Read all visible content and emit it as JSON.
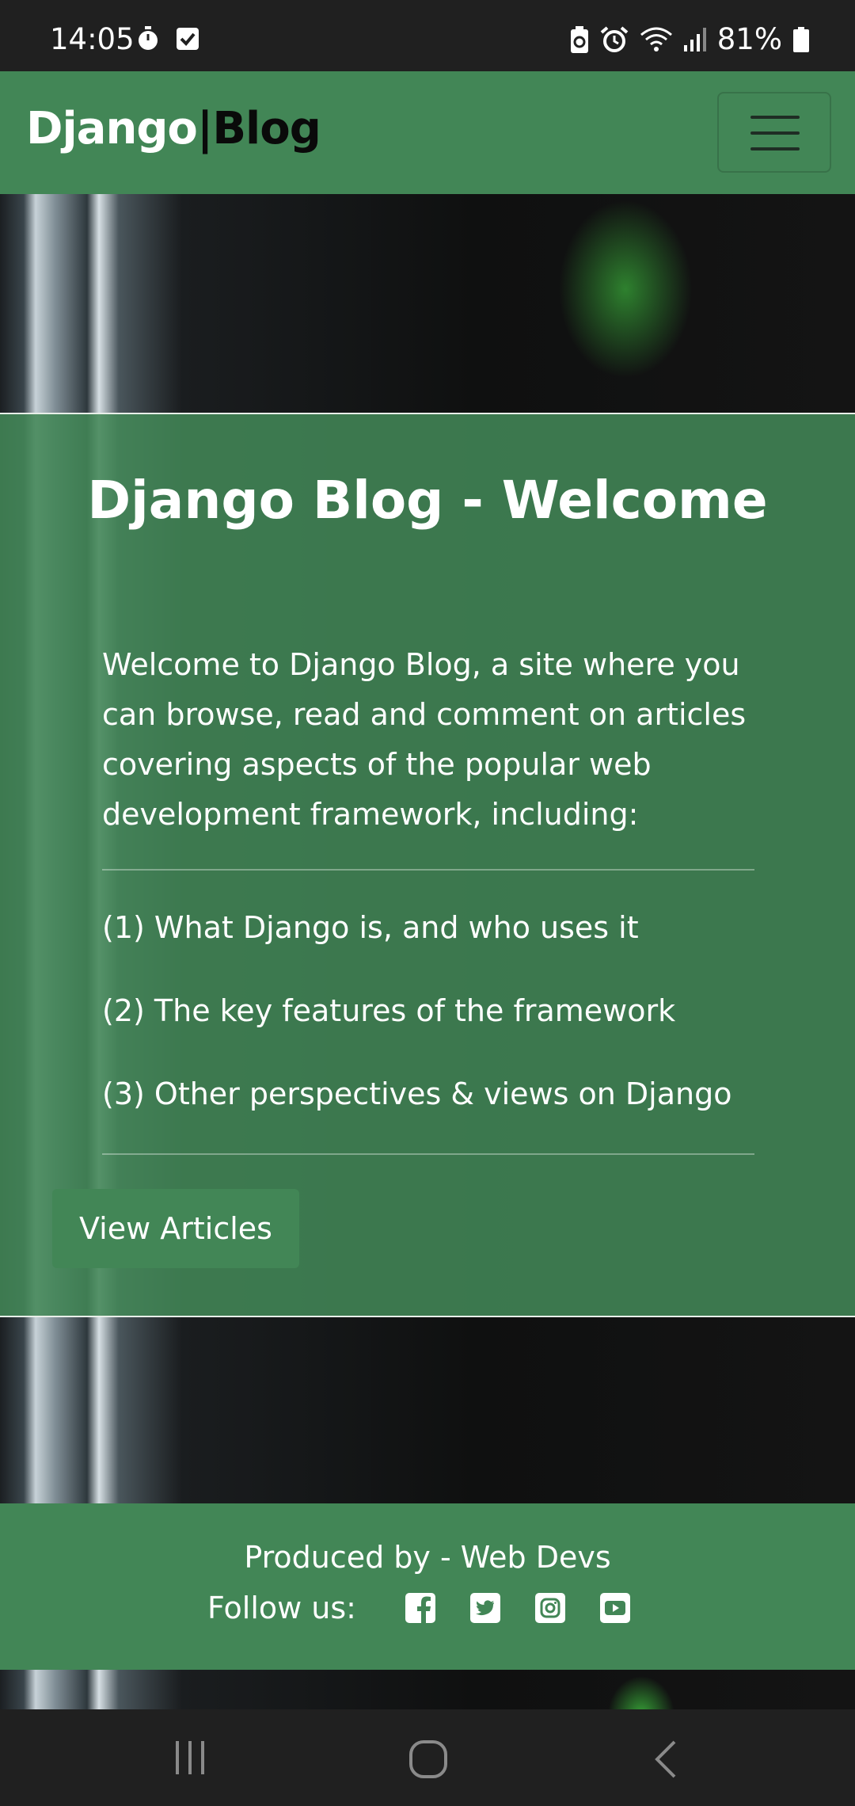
{
  "status_bar": {
    "time": "14:05",
    "battery_percent": "81%",
    "icons": [
      "timer-icon",
      "checkbox-icon",
      "battery-saver-icon",
      "alarm-icon",
      "wifi-icon",
      "signal-icon",
      "battery-icon"
    ]
  },
  "navbar": {
    "brand_left": "Django",
    "brand_separator": "|",
    "brand_right": "Blog",
    "menu_icon": "hamburger-menu-icon"
  },
  "welcome": {
    "title": "Django Blog - Welcome",
    "intro": "Welcome to Django Blog, a site where you can browse, read and comment on articles covering aspects of the popular web development framework, including:",
    "topics": [
      "(1) What Django is, and who uses it",
      "(2) The key features of the framework",
      "(3) Other perspectives & views on Django"
    ],
    "button_label": "View Articles"
  },
  "footer": {
    "produced_by": "Produced by - Web Devs",
    "follow_label": "Follow us:",
    "social_icons": [
      "facebook-icon",
      "twitter-icon",
      "instagram-icon",
      "youtube-icon"
    ]
  },
  "colors": {
    "brand_green": "#428656",
    "status_bar": "#202020"
  },
  "system_nav": {
    "icons": [
      "recent-apps-icon",
      "home-icon",
      "back-icon"
    ]
  }
}
